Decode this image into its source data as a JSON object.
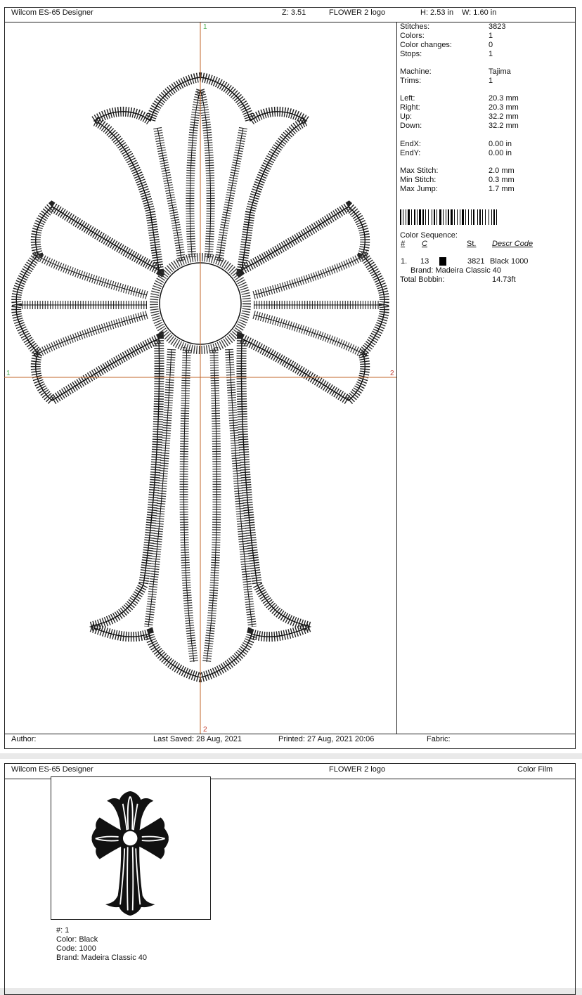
{
  "page1": {
    "header": {
      "app": "Wilcom ES-65 Designer",
      "zoom": "Z: 3.51",
      "design_name": "FLOWER 2 logo",
      "height": "H: 2.53 in",
      "width": "W: 1.60 in"
    },
    "axis_labels": {
      "top": "1",
      "bottom": "2",
      "left": "1",
      "right": "2"
    },
    "stats": {
      "group1": [
        {
          "label": "Stitches:",
          "value": "3823"
        },
        {
          "label": "Colors:",
          "value": "1"
        },
        {
          "label": "Color changes:",
          "value": "0"
        },
        {
          "label": "Stops:",
          "value": "1"
        }
      ],
      "group2": [
        {
          "label": "Machine:",
          "value": "Tajima"
        },
        {
          "label": "Trims:",
          "value": "1"
        }
      ],
      "group3": [
        {
          "label": "Left:",
          "value": "20.3 mm"
        },
        {
          "label": "Right:",
          "value": "20.3 mm"
        },
        {
          "label": "Up:",
          "value": "32.2 mm"
        },
        {
          "label": "Down:",
          "value": "32.2 mm"
        }
      ],
      "group4": [
        {
          "label": "EndX:",
          "value": "0.00 in"
        },
        {
          "label": "EndY:",
          "value": "0.00 in"
        }
      ],
      "group5": [
        {
          "label": "Max Stitch:",
          "value": "2.0 mm"
        },
        {
          "label": "Min Stitch:",
          "value": "0.3 mm"
        },
        {
          "label": "Max Jump:",
          "value": "1.7 mm"
        }
      ]
    },
    "color_sequence": {
      "title": "Color Sequence:",
      "headers": {
        "num": "#",
        "color": "C",
        "stitches": "St.",
        "descr_code": "Descr Code"
      },
      "rows": [
        {
          "index": "1.",
          "color_no": "13",
          "swatch": "#000000",
          "stitches": "3821",
          "descr": "Black 1000",
          "brand": "Brand: Madeira Classic 40"
        }
      ],
      "total_bobbin_label": "Total Bobbin:",
      "total_bobbin_value": "14.73ft"
    },
    "footer": {
      "author": "Author:",
      "last_saved": "Last Saved: 28 Aug, 2021",
      "printed": "Printed: 27 Aug, 2021 20:06",
      "fabric": "Fabric:"
    }
  },
  "page2": {
    "header": {
      "app": "Wilcom ES-65 Designer",
      "design_name": "FLOWER 2 logo",
      "view": "Color Film"
    },
    "color_info": {
      "number": "#: 1",
      "color": "Color: Black",
      "code": "Code: 1000",
      "brand": "Brand: Madeira Classic 40"
    }
  },
  "colors": {
    "axis": "#c0642a",
    "axis_label_top": "#4caf50",
    "axis_label_bottom": "#c0392b",
    "thread": "#111111"
  }
}
